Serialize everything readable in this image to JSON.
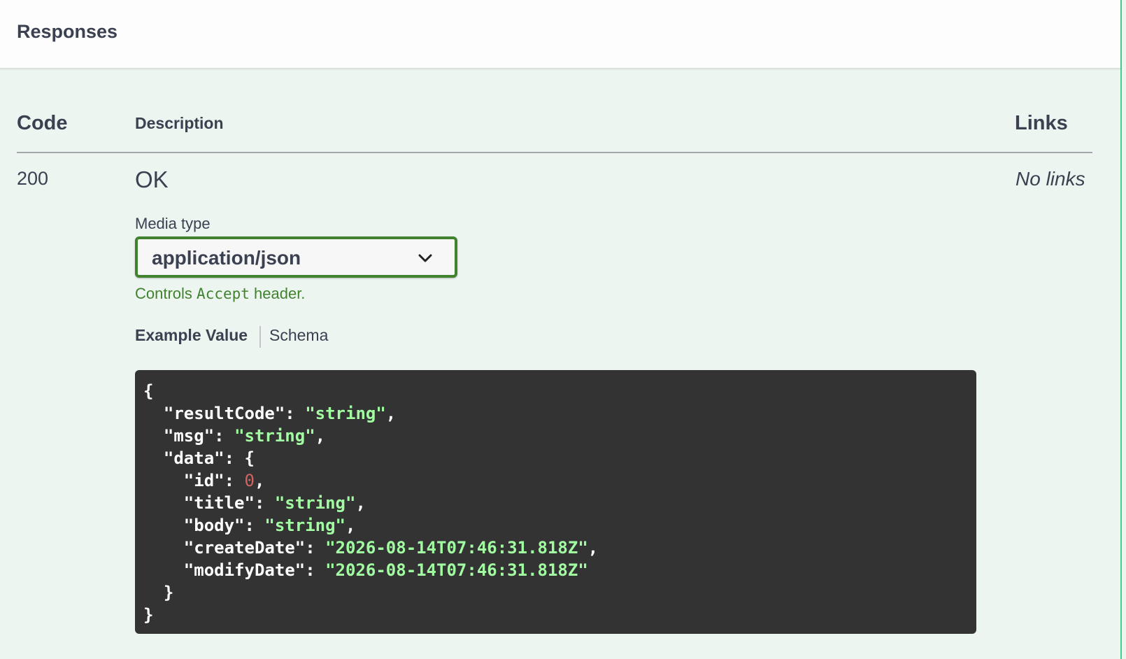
{
  "section": {
    "title": "Responses"
  },
  "table": {
    "headers": {
      "code": "Code",
      "description": "Description",
      "links": "Links"
    },
    "rows": [
      {
        "code": "200",
        "description": "OK",
        "links": "No links"
      }
    ]
  },
  "media_type": {
    "label": "Media type",
    "selected": "application/json",
    "hint_prefix": "Controls ",
    "hint_code": "Accept",
    "hint_suffix": " header."
  },
  "tabs": {
    "example_value": "Example Value",
    "schema": "Schema",
    "active": "example_value"
  },
  "example": {
    "lines": [
      [
        {
          "t": "p",
          "v": "{"
        }
      ],
      [
        {
          "t": "p",
          "v": "  "
        },
        {
          "t": "k",
          "v": "\"resultCode\""
        },
        {
          "t": "p",
          "v": ": "
        },
        {
          "t": "s",
          "v": "\"string\""
        },
        {
          "t": "p",
          "v": ","
        }
      ],
      [
        {
          "t": "p",
          "v": "  "
        },
        {
          "t": "k",
          "v": "\"msg\""
        },
        {
          "t": "p",
          "v": ": "
        },
        {
          "t": "s",
          "v": "\"string\""
        },
        {
          "t": "p",
          "v": ","
        }
      ],
      [
        {
          "t": "p",
          "v": "  "
        },
        {
          "t": "k",
          "v": "\"data\""
        },
        {
          "t": "p",
          "v": ": {"
        }
      ],
      [
        {
          "t": "p",
          "v": "    "
        },
        {
          "t": "k",
          "v": "\"id\""
        },
        {
          "t": "p",
          "v": ": "
        },
        {
          "t": "n",
          "v": "0"
        },
        {
          "t": "p",
          "v": ","
        }
      ],
      [
        {
          "t": "p",
          "v": "    "
        },
        {
          "t": "k",
          "v": "\"title\""
        },
        {
          "t": "p",
          "v": ": "
        },
        {
          "t": "s",
          "v": "\"string\""
        },
        {
          "t": "p",
          "v": ","
        }
      ],
      [
        {
          "t": "p",
          "v": "    "
        },
        {
          "t": "k",
          "v": "\"body\""
        },
        {
          "t": "p",
          "v": ": "
        },
        {
          "t": "s",
          "v": "\"string\""
        },
        {
          "t": "p",
          "v": ","
        }
      ],
      [
        {
          "t": "p",
          "v": "    "
        },
        {
          "t": "k",
          "v": "\"createDate\""
        },
        {
          "t": "p",
          "v": ": "
        },
        {
          "t": "s",
          "v": "\"2026-08-14T07:46:31.818Z\""
        },
        {
          "t": "p",
          "v": ","
        }
      ],
      [
        {
          "t": "p",
          "v": "    "
        },
        {
          "t": "k",
          "v": "\"modifyDate\""
        },
        {
          "t": "p",
          "v": ": "
        },
        {
          "t": "s",
          "v": "\"2026-08-14T07:46:31.818Z\""
        }
      ],
      [
        {
          "t": "p",
          "v": "  }"
        }
      ],
      [
        {
          "t": "p",
          "v": "}"
        }
      ]
    ]
  },
  "colors": {
    "accent_green": "#49cc90",
    "select_border": "#41822e",
    "string_value": "#a2fca2",
    "number_value": "#d36363",
    "code_background": "#333333"
  },
  "icons": {
    "select_arrow": "chevron-down-icon"
  }
}
